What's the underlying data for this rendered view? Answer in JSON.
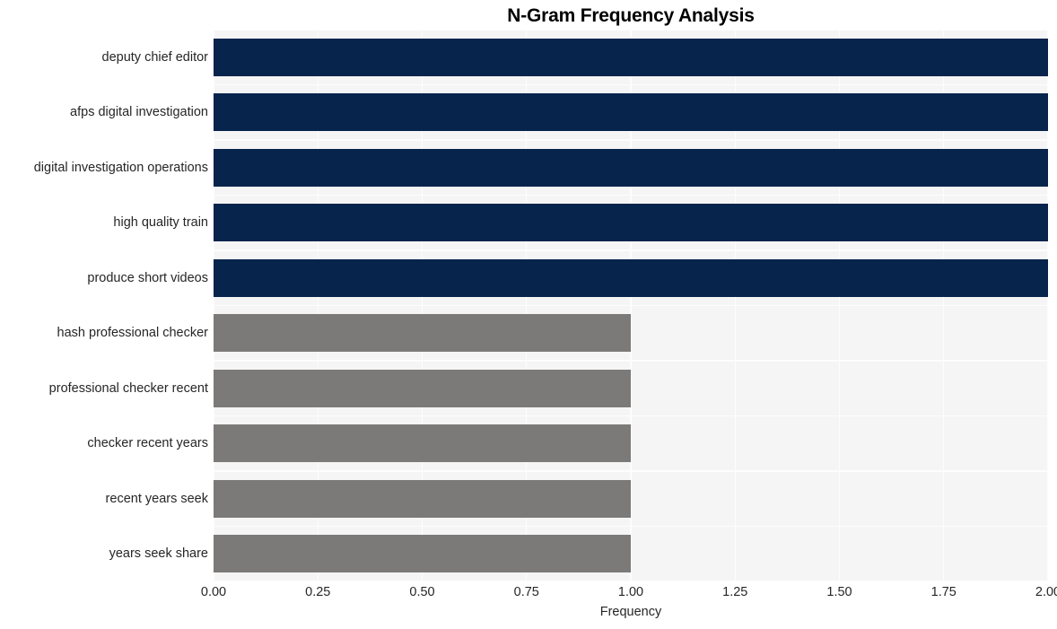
{
  "chart_data": {
    "type": "bar",
    "orientation": "horizontal",
    "title": "N-Gram Frequency Analysis",
    "xlabel": "Frequency",
    "ylabel": "",
    "xlim": [
      0,
      2
    ],
    "grid": true,
    "legend": null,
    "xticks": [
      "0.00",
      "0.25",
      "0.50",
      "0.75",
      "1.00",
      "1.25",
      "1.50",
      "1.75",
      "2.00"
    ],
    "xtick_values": [
      0,
      0.25,
      0.5,
      0.75,
      1,
      1.25,
      1.5,
      1.75,
      2
    ],
    "categories": [
      "deputy chief editor",
      "afps digital investigation",
      "digital investigation operations",
      "high quality train",
      "produce short videos",
      "hash professional checker",
      "professional checker recent",
      "checker recent years",
      "recent years seek",
      "years seek share"
    ],
    "values": [
      2,
      2,
      2,
      2,
      2,
      1,
      1,
      1,
      1,
      1
    ],
    "bar_colors": [
      "#06244c",
      "#06244c",
      "#06244c",
      "#06244c",
      "#06244c",
      "#7b7a78",
      "#7b7a78",
      "#7b7a78",
      "#7b7a78",
      "#7b7a78"
    ]
  },
  "style": {
    "plot_background": "#f5f5f6",
    "figure_background": "#ffffff",
    "gridline_color": "#fdfdfe",
    "tick_label_color": "#262626",
    "title_color": "#000000",
    "accent_primary": "#06244c",
    "accent_secondary": "#7b7a78"
  }
}
